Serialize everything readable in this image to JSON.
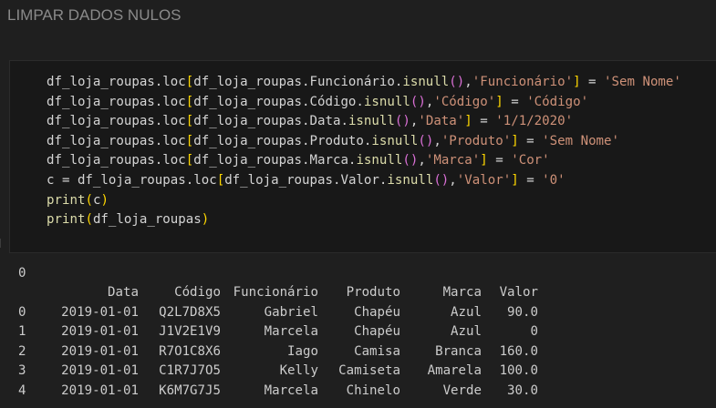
{
  "markdown": {
    "heading": "LIMPAR DADOS NULOS"
  },
  "code": {
    "lines": [
      "df_loja_roupas.loc[df_loja_roupas.Funcionário.isnull(),'Funcionário'] = 'Sem Nome'",
      "df_loja_roupas.loc[df_loja_roupas.Código.isnull(),'Código'] = 'Código'",
      "df_loja_roupas.loc[df_loja_roupas.Data.isnull(),'Data'] = '1/1/2020'",
      "df_loja_roupas.loc[df_loja_roupas.Produto.isnull(),'Produto'] = 'Sem Nome'",
      "df_loja_roupas.loc[df_loja_roupas.Marca.isnull(),'Marca'] = 'Cor'",
      "c = df_loja_roupas.loc[df_loja_roupas.Valor.isnull(),'Valor'] = '0'",
      "print(c)",
      "print(df_loja_roupas)"
    ]
  },
  "output": {
    "first_print": "0",
    "table": {
      "columns": [
        "",
        "Data",
        "Código",
        "Funcionário",
        "Produto",
        "Marca",
        "Valor"
      ],
      "rows": [
        [
          "0",
          "2019-01-01",
          "Q2L7D8X5",
          "Gabriel",
          "Chapéu",
          "Azul",
          "90.0"
        ],
        [
          "1",
          "2019-01-01",
          "J1V2E1V9",
          "Marcela",
          "Chapéu",
          "Azul",
          "0"
        ],
        [
          "2",
          "2019-01-01",
          "R7O1C8X6",
          "Iago",
          "Camisa",
          "Branca",
          "160.0"
        ],
        [
          "3",
          "2019-01-01",
          "C1R7J7O5",
          "Kelly",
          "Camiseta",
          "Amarela",
          "100.0"
        ],
        [
          "4",
          "2019-01-01",
          "K6M7G7J5",
          "Marcela",
          "Chinelo",
          "Verde",
          "30.0"
        ]
      ]
    }
  }
}
